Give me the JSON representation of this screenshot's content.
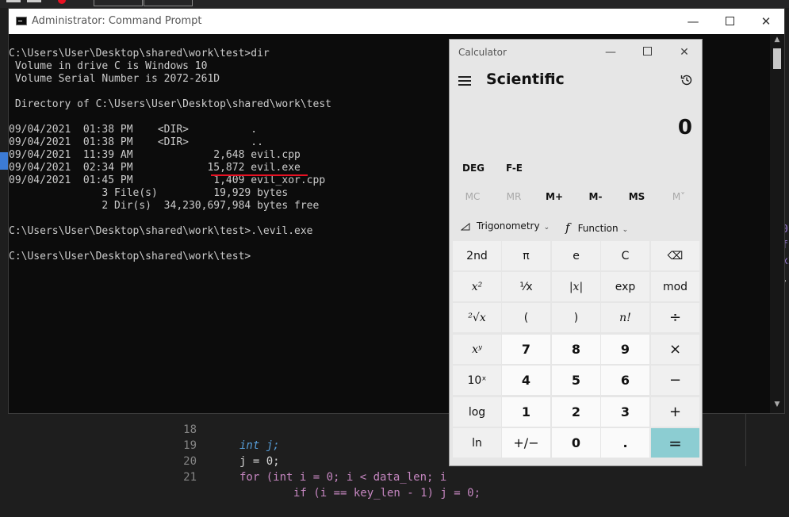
{
  "editor": {
    "lines": [
      {
        "num": "18",
        "code": "int j;"
      },
      {
        "num": "19",
        "code": "j = 0;"
      },
      {
        "num": "20",
        "code": "for (int i = 0; i < data_len; i"
      },
      {
        "num": "21",
        "code": "if (i == key_len - 1) j = 0;"
      }
    ]
  },
  "cmd": {
    "title": "Administrator: Command Prompt",
    "lines": [
      "C:\\Users\\User\\Desktop\\shared\\work\\test>dir",
      " Volume in drive C is Windows 10",
      " Volume Serial Number is 2072-261D",
      "",
      " Directory of C:\\Users\\User\\Desktop\\shared\\work\\test",
      "",
      "09/04/2021  01:38 PM    <DIR>          .",
      "09/04/2021  01:38 PM    <DIR>          ..",
      "09/04/2021  11:39 AM             2,648 evil.cpp",
      "09/04/2021  02:34 PM            15,872 evil.exe",
      "09/04/2021  01:45 PM             1,409 evil_xor.cpp",
      "               3 File(s)         19,929 bytes",
      "               2 Dir(s)  34,230,697,984 bytes free",
      "",
      "C:\\Users\\User\\Desktop\\shared\\work\\test>.\\evil.exe",
      "",
      "C:\\Users\\User\\Desktop\\shared\\work\\test>"
    ]
  },
  "calculator": {
    "title": "Calculator",
    "mode": "Scientific",
    "display": "0",
    "angle_mode": "DEG",
    "fe": "F-E",
    "memory": [
      "MC",
      "MR",
      "M+",
      "M-",
      "MS",
      "M˅"
    ],
    "trig_label": "Trigonometry",
    "func_label": "Function",
    "keys": {
      "r1": [
        "2nd",
        "π",
        "e",
        "C",
        "⌫"
      ],
      "r2": [
        "x²",
        "¹⁄x",
        "|x|",
        "exp",
        "mod"
      ],
      "r3": [
        "²√x",
        "(",
        ")",
        "n!",
        "÷"
      ],
      "r4": [
        "xʸ",
        "7",
        "8",
        "9",
        "×"
      ],
      "r5": [
        "10ˣ",
        "4",
        "5",
        "6",
        "−"
      ],
      "r6": [
        "log",
        "1",
        "2",
        "3",
        "+"
      ],
      "r7": [
        "ln",
        "+/−",
        "0",
        ".",
        "="
      ]
    }
  },
  "colors": {
    "equals_key": "#8ccdd2",
    "underline": "#e81123",
    "console_bg": "#0c0c0c"
  }
}
